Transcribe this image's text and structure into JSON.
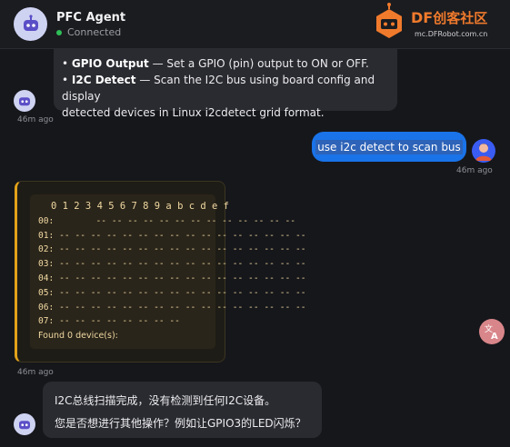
{
  "header": {
    "title": "PFC Agent",
    "status": "Connected",
    "status_color": "#2fbf57",
    "brand_prefix": "DF",
    "brand_cn": "创客社区",
    "brand_domain": "mc.DFRobot.com.cn",
    "avatar_icon": "robot-icon",
    "brand_icon": "robot-logo"
  },
  "messages": {
    "bot_intro": {
      "line1_bold": "GPIO Output",
      "line1_text": " — Set a GPIO (pin) output to ON or OFF.",
      "line2_bold": "I2C Detect",
      "line2_text": " — Scan the I2C bus using board config and display",
      "line3_text": "detected devices in Linux i2cdetect grid format.",
      "bullet": "•",
      "time": "46m ago"
    },
    "user": {
      "text": "use i2c detect to scan bus",
      "time": "46m ago"
    },
    "i2c_result": {
      "header": "0 1 2 3 4 5 6 7 8 9 a b c d e f",
      "rows": [
        "00:        -- -- -- -- -- -- -- -- -- -- -- -- --",
        "01: -- -- -- -- -- -- -- -- -- -- -- -- -- -- -- --",
        "02: -- -- -- -- -- -- -- -- -- -- -- -- -- -- -- --",
        "03: -- -- -- -- -- -- -- -- -- -- -- -- -- -- -- --",
        "04: -- -- -- -- -- -- -- -- -- -- -- -- -- -- -- --",
        "05: -- -- -- -- -- -- -- -- -- -- -- -- -- -- -- --",
        "06: -- -- -- -- -- -- -- -- -- -- -- -- -- -- -- --",
        "07: -- -- -- -- -- -- -- --"
      ],
      "found": "Found 0 device(s):",
      "time": "46m ago"
    },
    "bot_reply": {
      "line1": "I2C总线扫描完成，没有检测到任何I2C设备。",
      "line2": "您是否想进行其他操作？例如让GPIO3的LED闪烁？"
    }
  },
  "colors": {
    "accent_blue": "#1a73e8",
    "i2c_accent": "#e3a21a",
    "brand_orange": "#f07a2c"
  },
  "floating": {
    "translate_icon": "translate-icon"
  }
}
